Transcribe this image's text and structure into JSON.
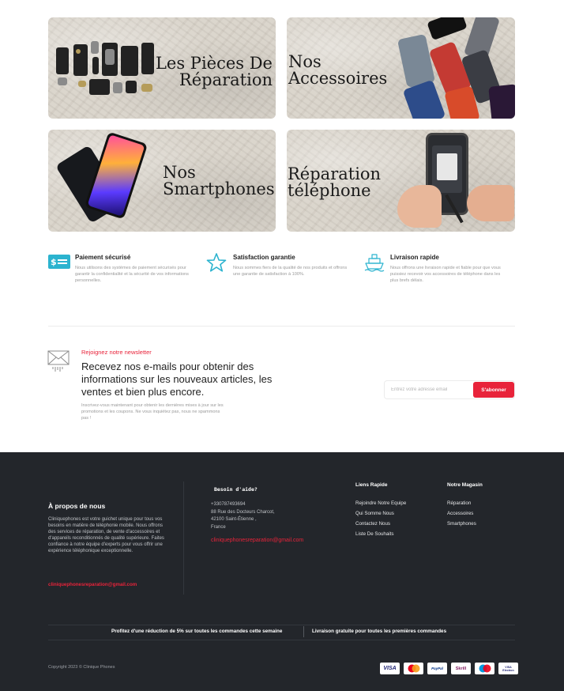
{
  "categories": {
    "parts": "Les Pièces De Réparation",
    "parts_line1": "Les Pièces De",
    "parts_line2": "Réparation",
    "accessories_line1": "Nos",
    "accessories_line2": "Accessoires",
    "smartphones_line1": "Nos",
    "smartphones_line2": "Smartphones",
    "repair_line1": "Réparation",
    "repair_line2": "téléphone"
  },
  "features": [
    {
      "title": "Paiement sécurisé",
      "desc": "Nous utilisons des systèmes de paiement sécurisés pour garantir la confidentialité et la sécurité de vos informations personnelles.",
      "icon": "card-icon"
    },
    {
      "title": "Satisfaction garantie",
      "desc": "Nous sommes fiers de la qualité de nos produits et offrons une garantie de satisfaction à 100%.",
      "icon": "star-icon"
    },
    {
      "title": "Livraison rapide",
      "desc": "Nous offrons une livraison rapide et fiable pour que vous puissiez recevoir vos accessoires de téléphone dans les plus brefs délais.",
      "icon": "ship-icon"
    }
  ],
  "newsletter": {
    "kicker": "Rejoignez notre newsletter",
    "title": "Recevez nos e-mails pour obtenir des informations sur les nouveaux articles, les ventes et bien plus encore.",
    "text": "Inscrivez-vous maintenant pour obtenir les dernières mises à jour sur les promotions et les coupons. Ne vous inquiétez pas, nous ne spammons pas !",
    "placeholder": "Entrez votre adresse email",
    "button": "S'abonner"
  },
  "footer": {
    "about_title": "À propos de nous",
    "about_text": "Cliniquephones est votre guichet unique pour tous vos besoins en matière de téléphonie mobile. Nous offrons des services de réparation, de vente d'accessoires et d'appareils reconditionnés de qualité supérieure. Faites confiance à notre équipe d'experts pour vous offrir une expérience téléphonique exceptionnelle.",
    "about_email": "cliniquephonesreparation@gmail.com",
    "help_title": "Besoin d'aide?",
    "phone": "+330787493694",
    "address1": "88 Rue des Docteurs Charcot,",
    "address2": "42100 Saint-Étienne ,",
    "country": "France",
    "help_email": "cliniquephonesreparation@gmail.com",
    "links_title": "Liens Rapide",
    "links": [
      "Rejoindre Notre Equipe",
      "Qui Somme Nous",
      "Contactez Nous",
      "Liste De Souhaits"
    ],
    "store_title": "Notre Magasin",
    "store": [
      "Réparation",
      "Accessoires",
      "Smartphones"
    ],
    "promo1": "Profitez d'une réduction de 5% sur toutes les commandes cette semaine",
    "promo2": "Livraison gratuite pour toutes les premières commandes",
    "copyright": "Copyright 2023 © Clinique Phones",
    "payments": [
      "VISA",
      "Mastercard",
      "PayPal",
      "Skrill",
      "Maestro",
      "VISA Electron"
    ]
  }
}
